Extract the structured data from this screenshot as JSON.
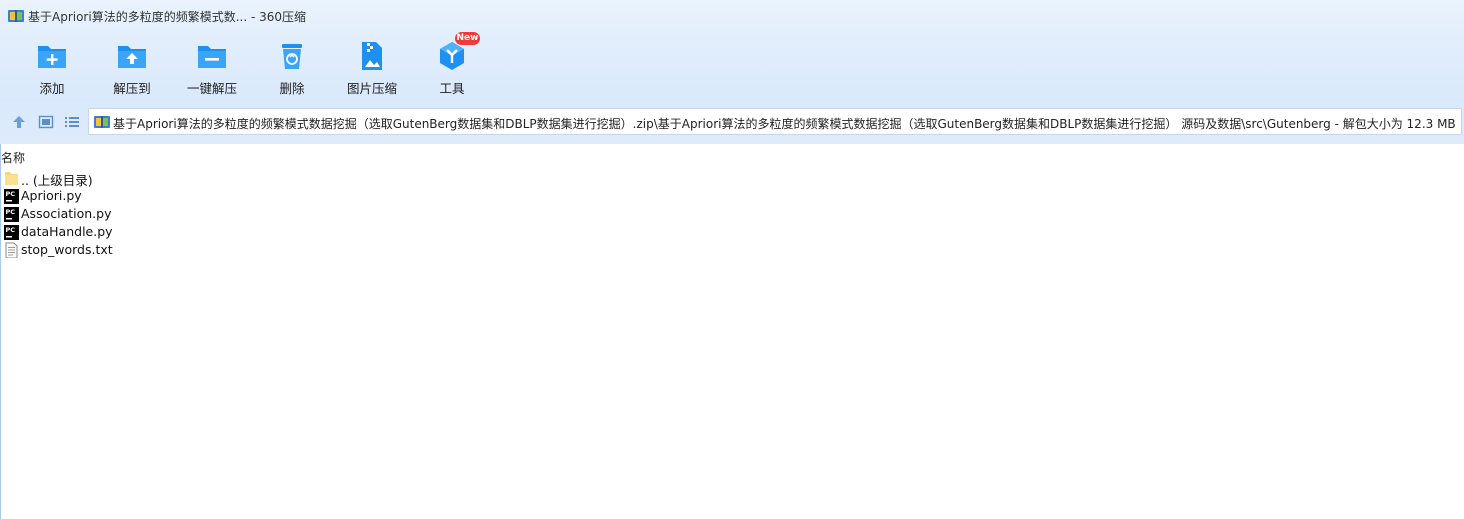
{
  "window": {
    "title": "基于Apriori算法的多粒度的频繁模式数... - 360压缩"
  },
  "toolbar": {
    "items": [
      {
        "label": "添加",
        "icon": "add-folder-icon"
      },
      {
        "label": "解压到",
        "icon": "extract-to-icon"
      },
      {
        "label": "一键解压",
        "icon": "one-click-extract-icon"
      },
      {
        "label": "删除",
        "icon": "delete-icon"
      },
      {
        "label": "图片压缩",
        "icon": "image-compress-icon"
      },
      {
        "label": "工具",
        "icon": "tools-icon"
      }
    ],
    "tools_badge": "New"
  },
  "addressbar": {
    "path": "基于Apriori算法的多粒度的频繁模式数据挖掘（选取GutenBerg数据集和DBLP数据集进行挖掘）.zip\\基于Apriori算法的多粒度的频繁模式数据挖掘（选取GutenBerg数据集和DBLP数据集进行挖掘） 源码及数据\\src\\Gutenberg - 解包大小为 12.3 MB"
  },
  "list": {
    "column_name": "名称",
    "files": [
      {
        "name": ".. (上级目录)",
        "icon": "folder-icon"
      },
      {
        "name": "Apriori.py",
        "icon": "pycharm-file-icon"
      },
      {
        "name": "Association.py",
        "icon": "pycharm-file-icon"
      },
      {
        "name": "dataHandle.py",
        "icon": "pycharm-file-icon"
      },
      {
        "name": "stop_words.txt",
        "icon": "text-file-icon"
      }
    ]
  },
  "colors": {
    "accent": "#1e90f0",
    "badge": "#f23a3a"
  }
}
